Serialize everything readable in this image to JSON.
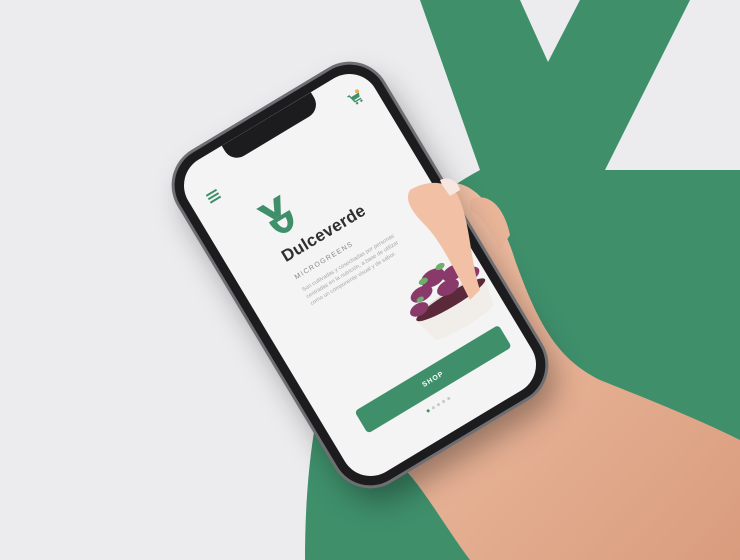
{
  "app": {
    "brand_name": "Dulceverde",
    "category_label": "MICROGREENS",
    "description": "Son cultivadas y cosechadas por personas centradas en la nutrición, a base de utilizar como un componente visual y de sabor.",
    "shop_button_label": "SHOP",
    "carousel": {
      "count": 5,
      "active_index": 0
    }
  },
  "icons": {
    "menu": "hamburger-menu-icon",
    "cart": "cart-icon",
    "logo": "dulceverde-logo-icon"
  },
  "colors": {
    "brand_green": "#3f8f6b",
    "background": "#ececee",
    "screen_bg": "#f4f4f5",
    "text_dark": "#2f2f2f",
    "text_muted": "#a7a7a7"
  }
}
